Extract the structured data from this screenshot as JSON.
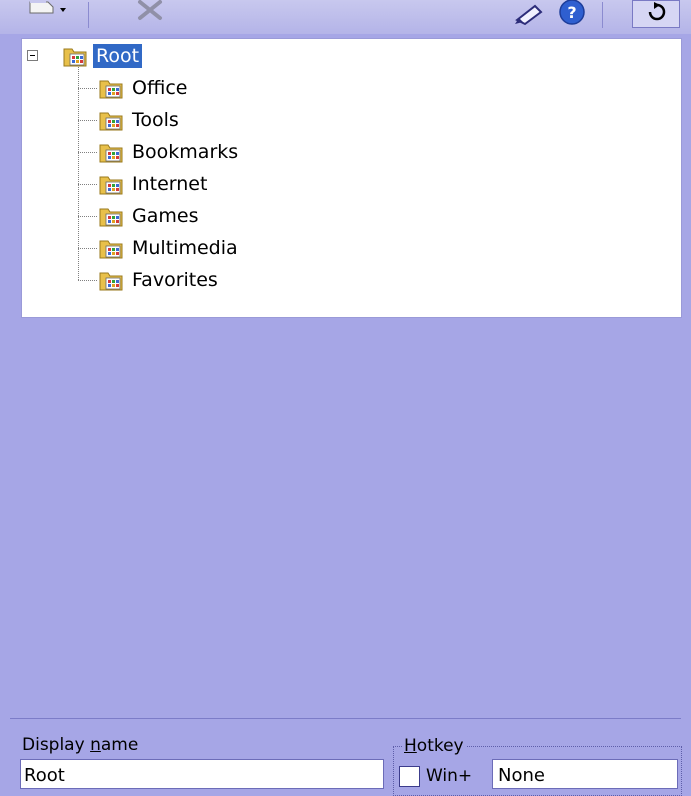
{
  "toolbar": {
    "buttons": [
      {
        "icon": "new-item-icon",
        "has_dropdown": true
      },
      {
        "icon": "delete-icon"
      },
      {
        "icon": "properties-icon"
      },
      {
        "icon": "help-icon"
      },
      {
        "icon": "refresh-icon"
      }
    ]
  },
  "tree": {
    "root": {
      "label": "Root",
      "selected": true,
      "expanded": true
    },
    "children": [
      {
        "label": "Office"
      },
      {
        "label": "Tools"
      },
      {
        "label": "Bookmarks"
      },
      {
        "label": "Internet"
      },
      {
        "label": "Games"
      },
      {
        "label": "Multimedia"
      },
      {
        "label": "Favorites"
      }
    ]
  },
  "properties": {
    "display_name_label_pre": "Display ",
    "display_name_label_key": "n",
    "display_name_label_post": "ame",
    "display_name_value": "Root",
    "hotkey_group_key": "H",
    "hotkey_group_rest": "otkey",
    "win_label": "Win+",
    "win_checked": false,
    "hotkey_value": "None"
  },
  "colors": {
    "background": "#a6a6e6",
    "selection": "#3169c6",
    "folder": "#e8c04a"
  }
}
